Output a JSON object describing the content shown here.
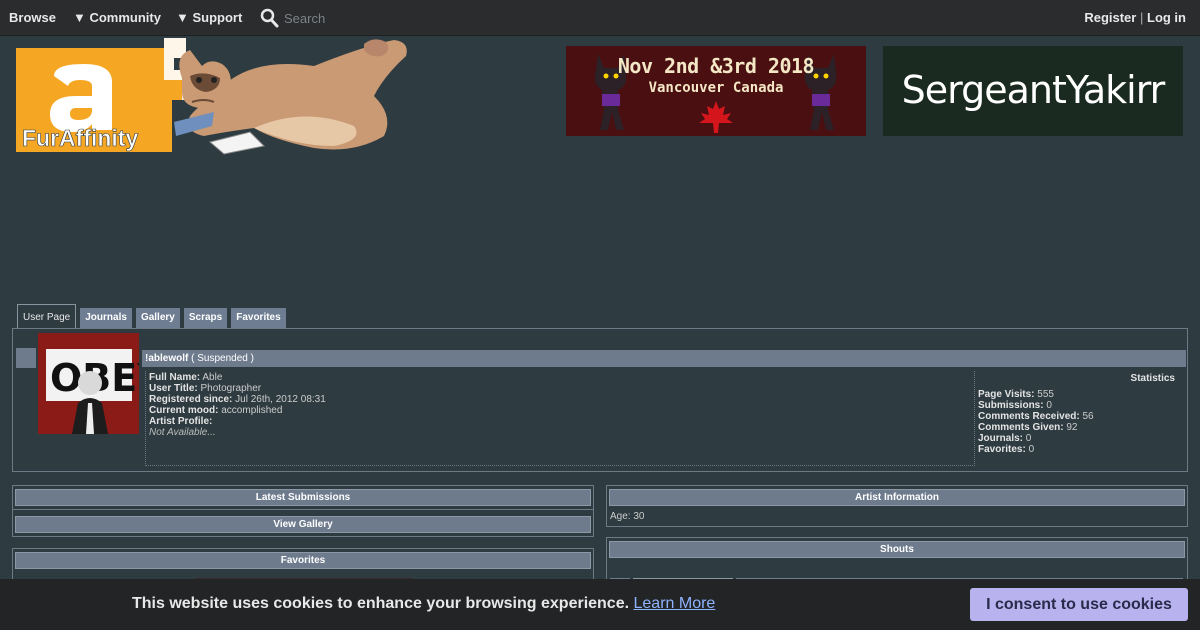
{
  "nav": {
    "browse": "Browse",
    "community": "▼ Community",
    "support": "▼ Support",
    "search_placeholder": "Search",
    "register": "Register",
    "separator": "|",
    "login": "Log in"
  },
  "logo": {
    "text": "FurAffinity",
    "letter": "a"
  },
  "banners": {
    "convention": {
      "line1": "Nov 2nd &3rd 2018",
      "line2": "Vancouver Canada"
    },
    "sponsor": {
      "text": "SergeantYakirr"
    }
  },
  "tabs": [
    "User Page",
    "Journals",
    "Gallery",
    "Scraps",
    "Favorites"
  ],
  "user": {
    "name": "!ablewolf",
    "status": "( Suspended )",
    "avatar_text": "OBEY",
    "fields": [
      {
        "label": "Full Name:",
        "value": "Able"
      },
      {
        "label": "User Title:",
        "value": "Photographer"
      },
      {
        "label": "Registered since:",
        "value": "Jul 26th, 2012 08:31"
      },
      {
        "label": "Current mood:",
        "value": "accomplished"
      },
      {
        "label": "Artist Profile:",
        "value": ""
      }
    ],
    "profile_value": "Not Available..."
  },
  "statistics": {
    "title": "Statistics",
    "items": [
      {
        "label": "Page Visits:",
        "value": "555"
      },
      {
        "label": "Submissions:",
        "value": "0"
      },
      {
        "label": "Comments Received:",
        "value": "56"
      },
      {
        "label": "Comments Given:",
        "value": "92"
      },
      {
        "label": "Journals:",
        "value": "0"
      },
      {
        "label": "Favorites:",
        "value": "0"
      }
    ]
  },
  "sections": {
    "latest_submissions": "Latest Submissions",
    "view_gallery": "View Gallery",
    "favorites": "Favorites",
    "artist_information": "Artist Information",
    "age": "Age: 30",
    "shouts": "Shouts"
  },
  "cookie": {
    "text": "This website uses cookies to enhance your browsing experience.",
    "link": "Learn More",
    "button": "I consent to use cookies"
  },
  "colors": {
    "background": "#2e3b41",
    "header_bar": "#6e7b8d",
    "logo_orange": "#f5a623",
    "cookie_button": "#b8b3ef"
  }
}
